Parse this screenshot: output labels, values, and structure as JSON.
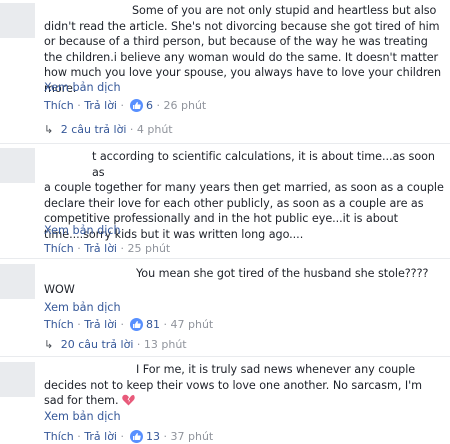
{
  "comments": [
    {
      "lead": "Some of you are not only stupid and heartless but also",
      "text": "didn't read the article. She's not divorcing because she got tired of him or because of a third person, but because of the way he was treating the children.i believe any woman would do the same. It doesn't matter how much you love your spouse, you always have to love your children more.",
      "translate": "Xem bản dịch",
      "like_label": "Thích",
      "reply_label": "Trả lời",
      "reaction_count": "6",
      "time": "26 phút",
      "replies_label": "2 câu trả lời",
      "replies_time": "4 phút"
    },
    {
      "lead": "t according to scientific calculations, it is about time...as soon as",
      "text": "a couple together for many years then get married, as soon as a couple declare their love for each other publicly, as soon as a couple are as competitive professionally and in the hot public eye...it is about time....sorry kids but it was written long ago....",
      "translate": "Xem bản dịch",
      "like_label": "Thích",
      "reply_label": "Trả lời",
      "time": "25 phút"
    },
    {
      "lead": "You mean she got tired of the husband she stole????",
      "text": "WOW",
      "translate": "Xem bản dịch",
      "like_label": "Thích",
      "reply_label": "Trả lời",
      "reaction_count": "81",
      "time": "47 phút",
      "replies_label": "20 câu trả lời",
      "replies_time": "13 phút"
    },
    {
      "lead": "I For me, it is truly sad news whenever any couple",
      "text": "decides not to keep their vows to love one another. No sarcasm, I'm sad for them.",
      "translate": "Xem bản dịch",
      "like_label": "Thích",
      "reply_label": "Trả lời",
      "reaction_count": "13",
      "time": "37 phút"
    }
  ],
  "colors": {
    "link": "#365899",
    "meta": "#90949c",
    "like_badge": "#5890ff",
    "broken_heart": "#e85a7a"
  },
  "icons": {
    "like": "thumbs-up-icon",
    "reply_arrow": "reply-arrow-icon",
    "emoji": "broken-heart-icon"
  }
}
